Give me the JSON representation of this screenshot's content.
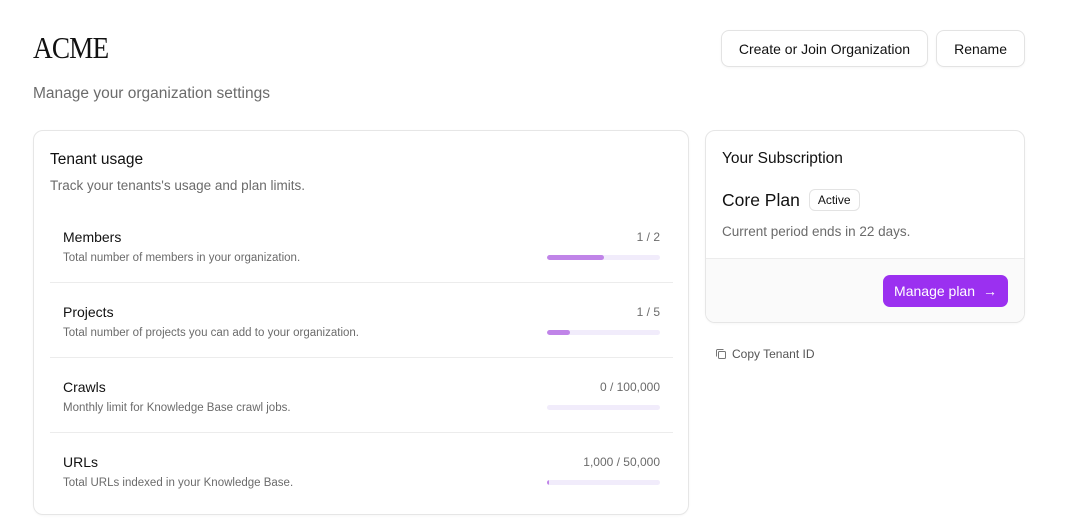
{
  "header": {
    "org_name": "ACME",
    "subtitle": "Manage your organization settings",
    "create_join_label": "Create or Join Organization",
    "rename_label": "Rename"
  },
  "usage": {
    "title": "Tenant usage",
    "description": "Track your tenants's usage and plan limits.",
    "items": [
      {
        "name": "Members",
        "description": "Total number of members in your organization.",
        "count": "1 / 2",
        "progress": 0.5
      },
      {
        "name": "Projects",
        "description": "Total number of projects you can add to your organization.",
        "count": "1 / 5",
        "progress": 0.2
      },
      {
        "name": "Crawls",
        "description": "Monthly limit for Knowledge Base crawl jobs.",
        "count": "0 / 100,000",
        "progress": 0.0
      },
      {
        "name": "URLs",
        "description": "Total URLs indexed in your Knowledge Base.",
        "count": "1,000 / 50,000",
        "progress": 0.02
      }
    ]
  },
  "subscription": {
    "title": "Your Subscription",
    "plan_name": "Core Plan",
    "status": "Active",
    "period": "Current period ends in 22 days.",
    "manage_label": "Manage plan"
  },
  "copy_tenant_label": "Copy Tenant ID",
  "colors": {
    "accent": "#9b30f0",
    "bar_fill": "#c084e8",
    "bar_track": "#f1ecfb"
  }
}
